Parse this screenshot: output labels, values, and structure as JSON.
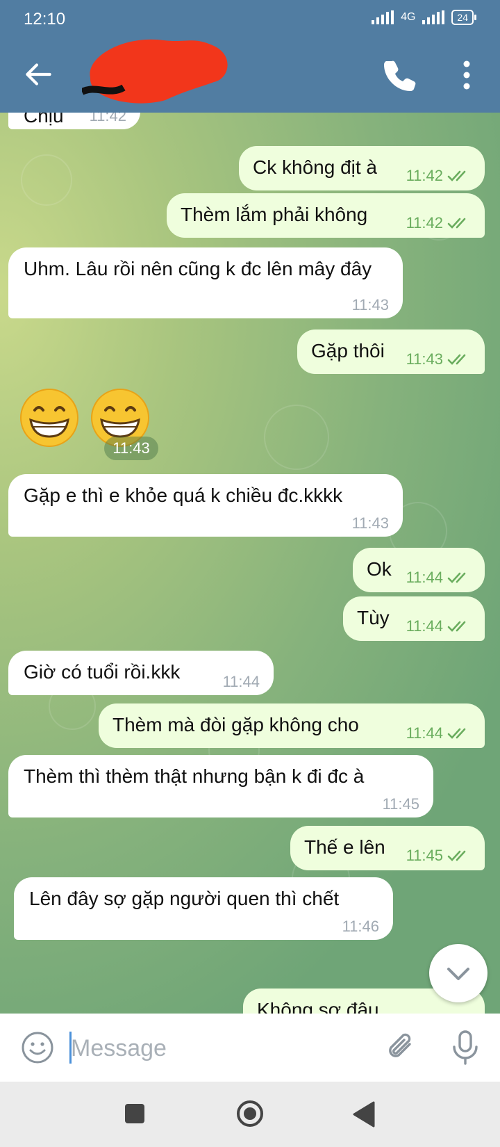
{
  "status": {
    "time": "12:10",
    "network": "4G",
    "battery": "24"
  },
  "header": {
    "contact_name": "",
    "subtitle": ""
  },
  "messages": [
    {
      "dir": "in",
      "text": "Chịu",
      "time": "11:42"
    },
    {
      "dir": "out",
      "text": "Ck không địt à",
      "time": "11:42"
    },
    {
      "dir": "out",
      "text": "Thèm lắm phải không",
      "time": "11:42"
    },
    {
      "dir": "in",
      "text": "Uhm. Lâu rồi nên cũng k đc lên mây đây",
      "time": "11:43"
    },
    {
      "dir": "out",
      "text": "Gặp thôi",
      "time": "11:43"
    },
    {
      "dir": "in",
      "text": "😁😁",
      "time": "11:43"
    },
    {
      "dir": "in",
      "text": "Gặp e thì e khỏe quá k chiều đc.kkkk",
      "time": "11:43"
    },
    {
      "dir": "out",
      "text": "Ok",
      "time": "11:44"
    },
    {
      "dir": "out",
      "text": "Tùy",
      "time": "11:44"
    },
    {
      "dir": "in",
      "text": "Giờ có tuổi rồi.kkk",
      "time": "11:44"
    },
    {
      "dir": "out",
      "text": "Thèm mà đòi gặp không cho",
      "time": "11:44"
    },
    {
      "dir": "in",
      "text": "Thèm thì thèm thật nhưng bận k đi đc à",
      "time": "11:45"
    },
    {
      "dir": "out",
      "text": "Thế e lên",
      "time": "11:45"
    },
    {
      "dir": "in",
      "text": "Lên đây sợ gặp người quen thì chết",
      "time": "11:46"
    },
    {
      "dir": "out",
      "text": "Không sợ đâu",
      "time": ""
    }
  ],
  "input": {
    "placeholder": "Message"
  },
  "icons": {
    "back": "arrow-left-icon",
    "call": "phone-icon",
    "more": "more-vertical-icon",
    "emoji": "smile-icon",
    "attach": "paperclip-icon",
    "mic": "microphone-icon",
    "scroll": "chevron-down-icon",
    "read": "double-check-icon"
  },
  "colors": {
    "header": "#517da2",
    "incoming_bubble": "#ffffff",
    "outgoing_bubble": "#effedd",
    "read_ticks": "#6aad5e",
    "time_gray": "#a1aab3"
  }
}
